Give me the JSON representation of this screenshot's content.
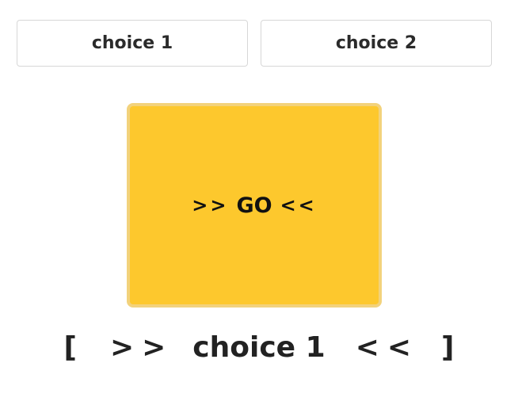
{
  "choices": [
    {
      "label": "choice 1"
    },
    {
      "label": "choice 2"
    }
  ],
  "go_button": {
    "left_arrows": ">>",
    "label": "GO",
    "right_arrows": "<<"
  },
  "result": {
    "open_bracket": "[",
    "left_arrows": ">>",
    "value": "choice 1",
    "right_arrows": "<<",
    "close_bracket": "]"
  },
  "colors": {
    "go_fill": "#fdc82d",
    "go_border": "#f2d27c",
    "button_border": "#d7d7d7"
  }
}
